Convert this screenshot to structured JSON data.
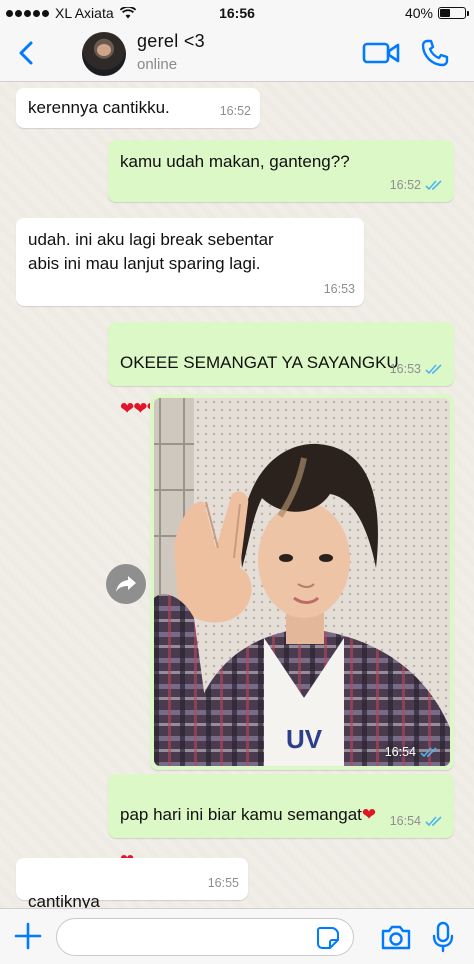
{
  "status_bar": {
    "carrier": "XL Axiata",
    "time": "16:56",
    "battery": "40%",
    "battery_level": 0.4
  },
  "header": {
    "contact_name": "gerel <3",
    "contact_status": "online",
    "back_icon": "chevron-left-icon",
    "video_icon": "video-camera-icon",
    "call_icon": "phone-icon"
  },
  "messages": [
    {
      "direction": "in",
      "text": "kerennya cantikku.",
      "time": "16:52"
    },
    {
      "direction": "out",
      "text": "kamu udah makan, ganteng??",
      "time": "16:52",
      "read": true
    },
    {
      "direction": "in",
      "text": "udah. ini aku lagi break sebentar\nabis ini mau lanjut sparing lagi.",
      "time": "16:53"
    },
    {
      "direction": "out",
      "text": "OKEEE SEMANGAT YA SAYANGKU",
      "hearts": "❤❤❤",
      "time": "16:53",
      "read": true
    },
    {
      "direction": "out",
      "type": "photo",
      "time": "16:54",
      "read": true
    },
    {
      "direction": "out",
      "text": "pap hari ini biar kamu semangat",
      "hearts_inline": "❤",
      "hearts": "❤",
      "time": "16:54",
      "read": true
    },
    {
      "direction": "in",
      "text": "cantiknya",
      "hearts": "❤❤❤",
      "time": "16:55"
    }
  ],
  "input": {
    "placeholder": "",
    "value": ""
  },
  "colors": {
    "accent": "#007aff",
    "bubble_out": "#dcf8c6",
    "bubble_in": "#ffffff",
    "read_ticks": "#4fb6ec",
    "hearts": "#e0152a"
  }
}
